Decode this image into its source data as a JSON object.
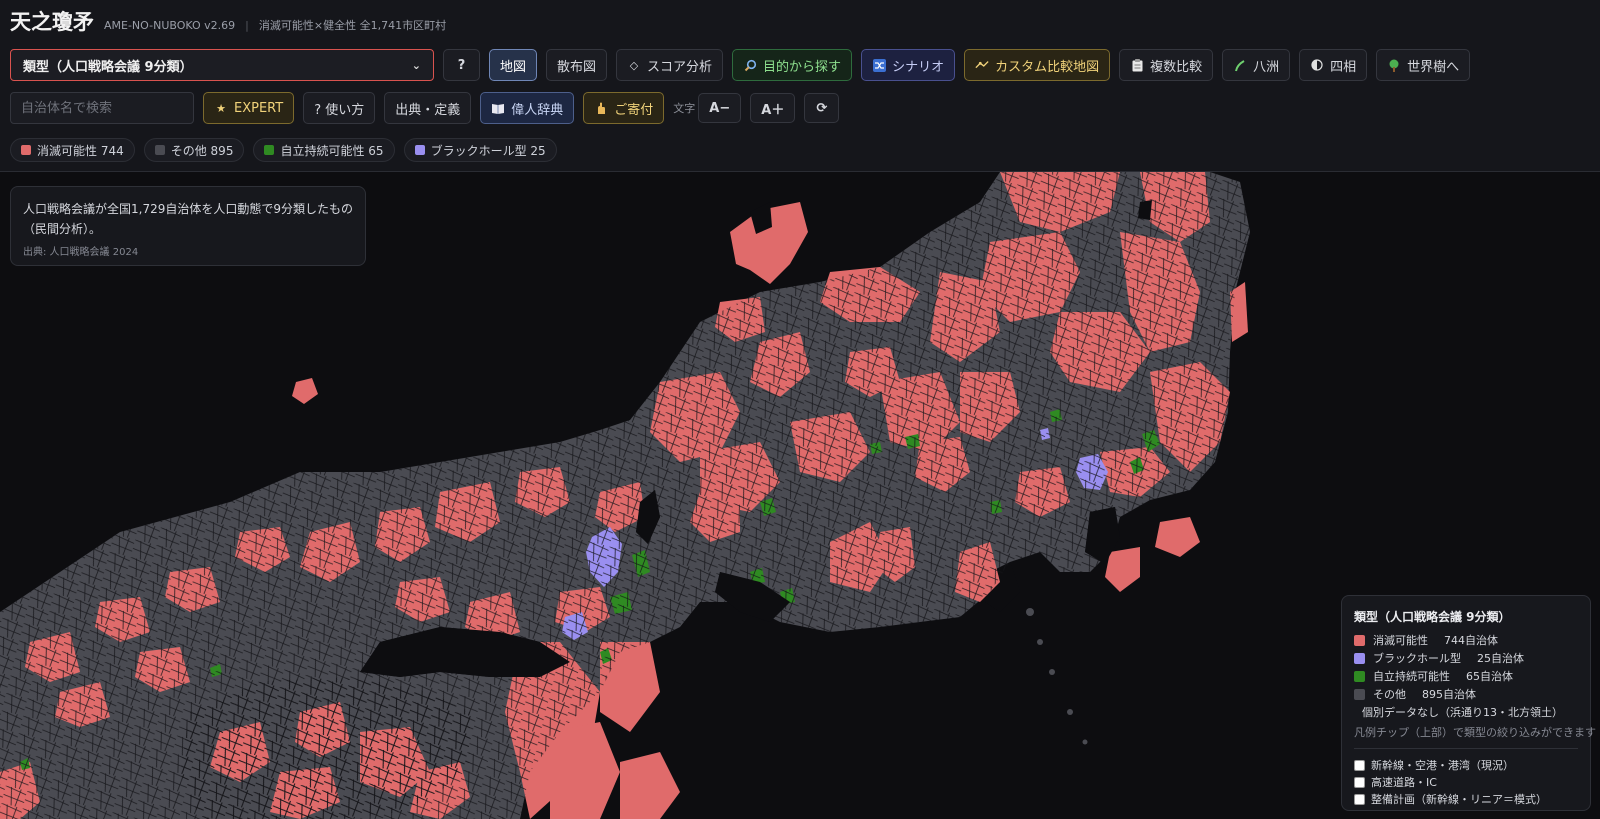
{
  "header": {
    "title": "天之瓊矛",
    "version": "AME-NO-NUBOKO v2.69",
    "separator": "|",
    "subtitle": "消滅可能性×健全性 全1,741市区町村"
  },
  "toolbar": {
    "select_value": "類型（人口戦略会議 9分類）",
    "help_label": "?",
    "map_label": "地図",
    "scatter_label": "散布図",
    "score_label": "スコア分析",
    "purpose_label": "目的から探す",
    "scenario_label": "シナリオ",
    "custom_map_label": "カスタム比較地図",
    "multi_compare_label": "複数比較",
    "yashima_label": "八洲",
    "shiso_label": "四相",
    "world_tree_label": "世界樹へ"
  },
  "toolbar2": {
    "search_placeholder": "自治体名で検索",
    "expert_label": "EXPERT",
    "howto_label": "? 使い方",
    "source_label": "出典・定義",
    "dictionary_label": "偉人辞典",
    "donate_label": "ご寄付",
    "font_label": "文字",
    "font_minus_label": "A−",
    "font_plus_label": "A＋",
    "reset_icon_label": "⟳"
  },
  "chips": [
    {
      "label": "消滅可能性 744",
      "color": "#e06b6b"
    },
    {
      "label": "その他 895",
      "color": "#4a4b52"
    },
    {
      "label": "自立持続可能性 65",
      "color": "#2f8a22"
    },
    {
      "label": "ブラックホール型 25",
      "color": "#9a8ff0"
    }
  ],
  "info": {
    "text": "人口戦略会議が全国1,729自治体を人口動態で9分類したもの（民間分析）。",
    "source": "出典: 人口戦略会議 2024"
  },
  "legend": {
    "title": "類型（人口戦略会議 9分類）",
    "items": [
      {
        "label": "消滅可能性",
        "count": "744自治体",
        "color": "#e06b6b"
      },
      {
        "label": "ブラックホール型",
        "count": "25自治体",
        "color": "#9a8ff0"
      },
      {
        "label": "自立持続可能性",
        "count": "65自治体",
        "color": "#2f8a22"
      },
      {
        "label": "その他",
        "count": "895自治体",
        "color": "#4a4b52"
      },
      {
        "label": "個別データなし（浜通り13・北方領土）",
        "count": "",
        "color": "#26272c"
      }
    ],
    "note": "凡例チップ（上部）で類型の絞り込みができます",
    "checks": [
      "新幹線・空港・港湾（現況）",
      "高速道路・IC",
      "整備計画（新幹線・リニア＝模式）"
    ]
  },
  "colors": {
    "shometsu": "#e06b6b",
    "sonota": "#4a4b52",
    "jiritsu": "#2f8a22",
    "blackhole": "#9a8ff0",
    "sea": "#0d0d10"
  },
  "icons": {
    "score": "diamond-icon",
    "purpose": "magnifier-icon",
    "scenario": "shuffle-icon",
    "custom_map": "map-pin-icon",
    "multi_compare": "clipboard-icon",
    "yashima": "branch-icon",
    "shiso": "half-circle-icon",
    "world_tree": "tree-icon",
    "dictionary": "book-icon",
    "donate": "hand-icon",
    "reset": "reload-icon"
  }
}
